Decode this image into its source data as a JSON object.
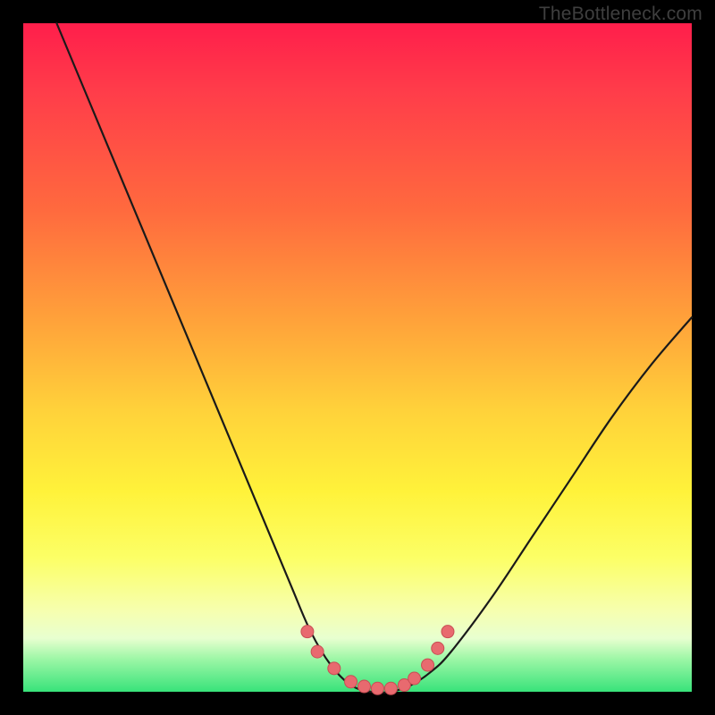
{
  "watermark": "TheBottleneck.com",
  "colors": {
    "frame": "#000000",
    "curve_stroke": "#1a1a1a",
    "marker_fill": "#e86a6f",
    "marker_stroke": "#c94e54",
    "gradient_top": "#ff1e4b",
    "gradient_bottom": "#38e37a"
  },
  "chart_data": {
    "type": "line",
    "title": "",
    "xlabel": "",
    "ylabel": "",
    "xlim": [
      0,
      100
    ],
    "ylim": [
      0,
      100
    ],
    "grid": false,
    "legend": false,
    "series": [
      {
        "name": "bottleneck-curve",
        "x": [
          5,
          10,
          15,
          20,
          25,
          30,
          35,
          40,
          43,
          46,
          49,
          52,
          55,
          58,
          61,
          64,
          70,
          76,
          82,
          88,
          94,
          100
        ],
        "y": [
          100,
          88,
          76,
          64,
          52,
          40,
          28,
          16,
          9,
          4,
          1,
          0,
          0,
          1,
          3,
          6,
          14,
          23,
          32,
          41,
          49,
          56
        ]
      }
    ],
    "markers": {
      "name": "highlight-points",
      "x": [
        42.5,
        44,
        46.5,
        49,
        51,
        53,
        55,
        57,
        58.5,
        60.5,
        62,
        63.5
      ],
      "y": [
        9,
        6,
        3.5,
        1.5,
        0.8,
        0.5,
        0.5,
        1,
        2,
        4,
        6.5,
        9
      ]
    }
  }
}
